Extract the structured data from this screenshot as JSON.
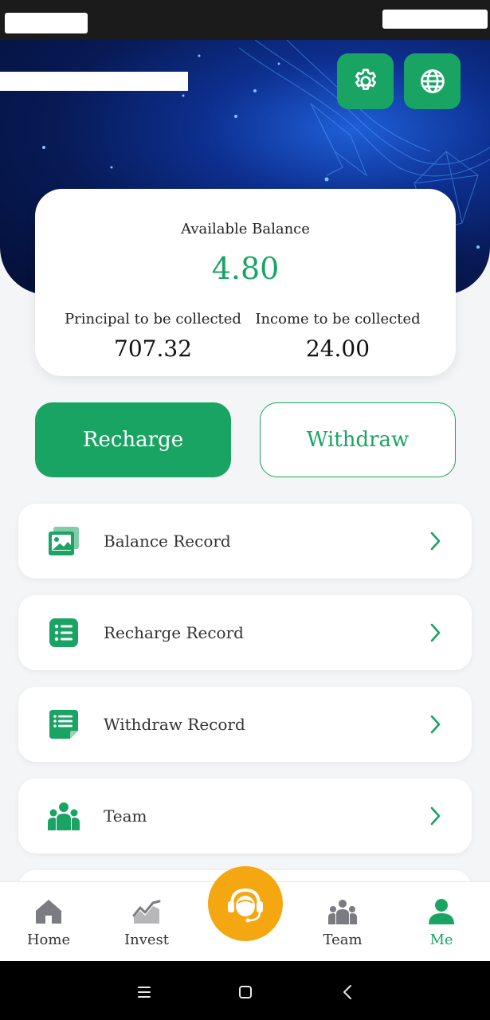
{
  "balance": {
    "available_label": "Available Balance",
    "available_value": "4.80",
    "principal_label": "Principal to be collected",
    "principal_value": "707.32",
    "income_label": "Income to be collected",
    "income_value": "24.00"
  },
  "actions": {
    "recharge_label": "Recharge",
    "withdraw_label": "Withdraw"
  },
  "menu": [
    {
      "label": "Balance Record",
      "icon": "image-gallery-icon"
    },
    {
      "label": "Recharge Record",
      "icon": "list-icon"
    },
    {
      "label": "Withdraw Record",
      "icon": "document-list-icon"
    },
    {
      "label": "Team",
      "icon": "group-icon"
    }
  ],
  "nav": {
    "home": "Home",
    "invest": "Invest",
    "team": "Team",
    "me": "Me"
  },
  "colors": {
    "accent": "#1aa463",
    "support": "#f5a712",
    "hero": "#0d2f8f"
  }
}
